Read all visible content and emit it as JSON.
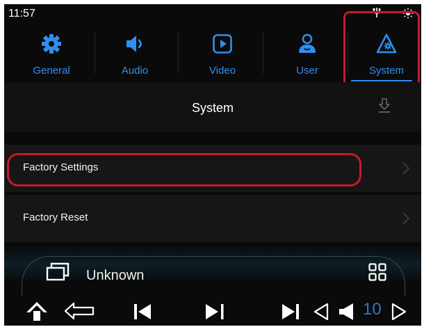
{
  "status_bar": {
    "time": "11:57",
    "icons": [
      "usb-icon",
      "brightness-icon"
    ]
  },
  "tabs": [
    {
      "label": "General",
      "icon": "gear-icon"
    },
    {
      "label": "Audio",
      "icon": "speaker-icon"
    },
    {
      "label": "Video",
      "icon": "play-icon"
    },
    {
      "label": "User",
      "icon": "user-icon"
    },
    {
      "label": "System",
      "icon": "system-icon",
      "selected": true
    }
  ],
  "page": {
    "title": "System",
    "action_icon": "download-icon"
  },
  "list": [
    {
      "label": "Factory Settings",
      "icon": "chevron-right-icon"
    },
    {
      "label": "Factory Reset",
      "icon": "chevron-right-icon"
    }
  ],
  "media": {
    "title": "Unknown"
  },
  "nav": {
    "buttons": [
      "home-icon",
      "back-icon",
      "previous-icon",
      "play-pause-icon",
      "next-icon",
      "volume-down-icon",
      "volume-icon",
      "volume-up-icon"
    ],
    "volume": "10"
  },
  "colors": {
    "accent": "#2f8ff0",
    "highlight": "#c8192b",
    "background": "#0a0a0a",
    "volume": "#2f76c8"
  }
}
